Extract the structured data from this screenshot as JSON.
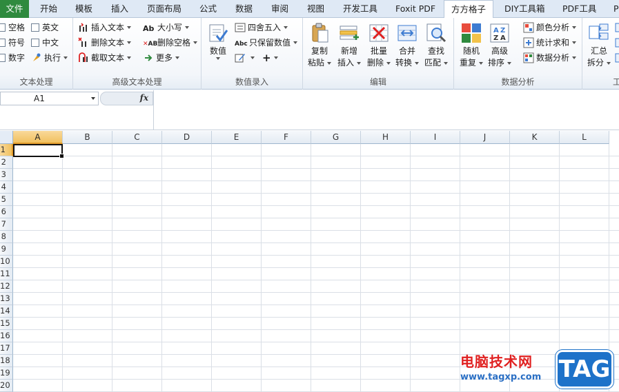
{
  "tabs": [
    {
      "label": "文件"
    },
    {
      "label": "开始"
    },
    {
      "label": "模板"
    },
    {
      "label": "插入"
    },
    {
      "label": "页面布局"
    },
    {
      "label": "公式"
    },
    {
      "label": "数据"
    },
    {
      "label": "审阅"
    },
    {
      "label": "视图"
    },
    {
      "label": "开发工具"
    },
    {
      "label": "Foxit PDF"
    },
    {
      "label": "方方格子"
    },
    {
      "label": "DIY工具箱"
    },
    {
      "label": "PDF工具"
    },
    {
      "label": "P"
    }
  ],
  "active_tab": "方方格子",
  "ribbon": {
    "text_processing": {
      "label": "文本处理",
      "items": [
        "空格",
        "英文",
        "符号",
        "中文",
        "数字",
        "执行"
      ]
    },
    "advanced_text": {
      "label": "高级文本处理",
      "insert_text": "插入文本",
      "delete_text": "删除文本",
      "extract_text": "截取文本",
      "case": "大小写",
      "delete_space": "删除空格",
      "more": "更多"
    },
    "number_entry": {
      "label": "数值录入",
      "value_l1": "数值",
      "round": "四舍五入",
      "keep_values": "只保留数值",
      "plus": "+"
    },
    "edit": {
      "label": "编辑",
      "copy_l1": "复制",
      "copy_l2": "粘贴",
      "insert_l1": "新增",
      "insert_l2": "插入",
      "batch_l1": "批量",
      "batch_l2": "删除",
      "merge_l1": "合并",
      "merge_l2": "转换",
      "find_l1": "查找",
      "find_l2": "匹配"
    },
    "data_analysis": {
      "label": "数据分析",
      "random_l1": "随机",
      "random_l2": "重复",
      "sort_l1": "高级",
      "sort_l2": "排序",
      "color_analysis": "颜色分析",
      "stat_sum": "统计求和",
      "data_analysis": "数据分析"
    },
    "worksheet": {
      "label": "工",
      "summary_l1": "汇总",
      "summary_l2": "拆分"
    }
  },
  "formula_bar": {
    "name_box": "A1",
    "fx": "fx",
    "formula": ""
  },
  "grid": {
    "columns": [
      "A",
      "B",
      "C",
      "D",
      "E",
      "F",
      "G",
      "H",
      "I",
      "J",
      "K",
      "L"
    ],
    "rows": [
      "1",
      "2",
      "3",
      "4",
      "5",
      "6",
      "7",
      "8",
      "9",
      "10",
      "11",
      "12",
      "13",
      "14",
      "15",
      "16",
      "17",
      "18",
      "19",
      "20"
    ],
    "active_cell": "A1"
  },
  "watermark": {
    "site": "电脑技术网",
    "url": "www.tagxp.com",
    "tag": "TAG"
  },
  "colors": {
    "file_tab": "#2f8a3e",
    "selected_header": "#f1c15f",
    "watermark_red": "#e02020",
    "watermark_blue": "#1e72c9"
  }
}
